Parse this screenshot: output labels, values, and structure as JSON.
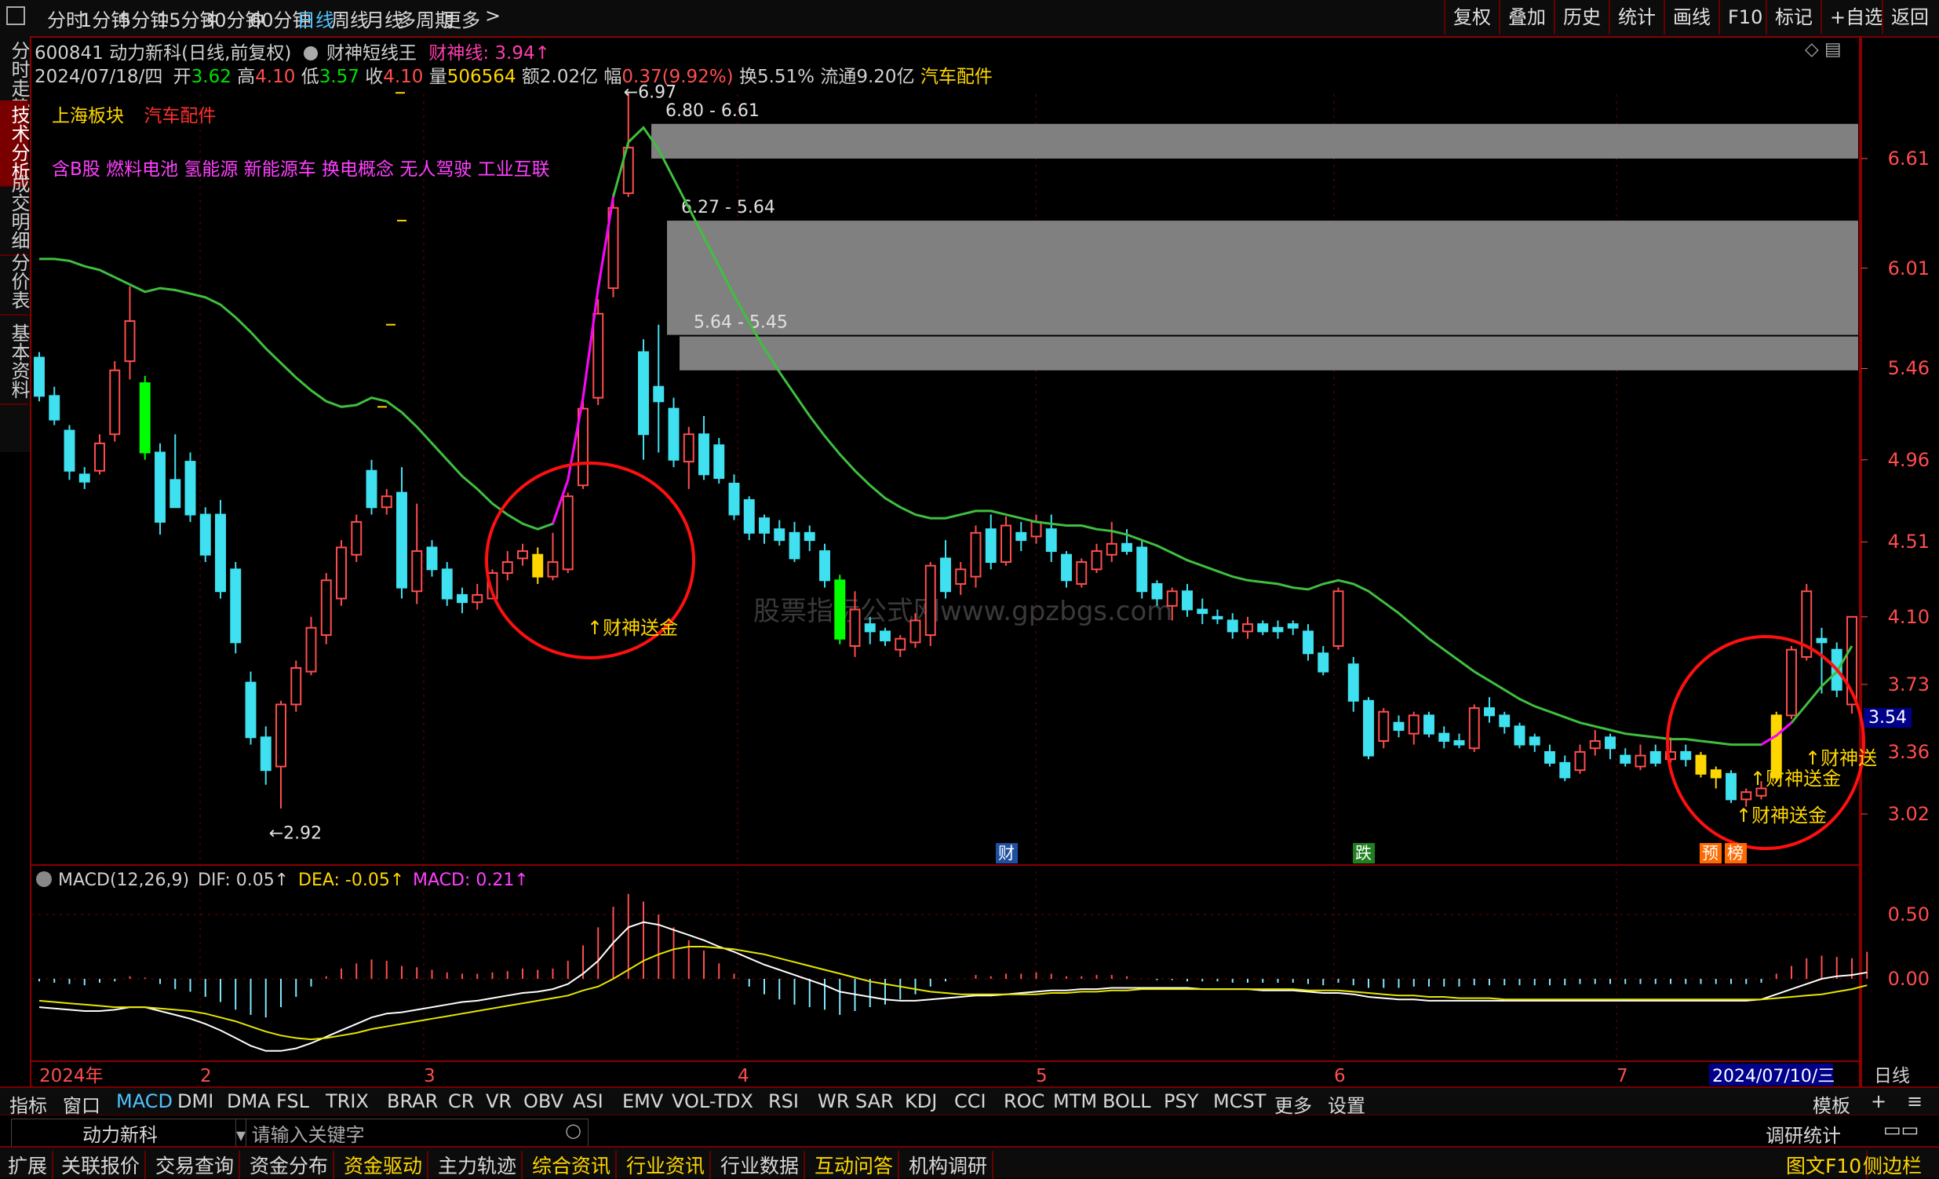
{
  "topbar": {
    "menu_icon": "window-menu-icon",
    "periods": [
      "分时",
      "1分钟",
      "5分钟",
      "15分钟",
      "30分钟",
      "60分钟",
      "日线",
      "周线",
      "月线",
      "多周期",
      "更多"
    ],
    "active_period": "日线",
    "right_buttons": [
      "复权",
      "叠加",
      "历史",
      "统计",
      "画线",
      "F10",
      "标记",
      "+自选",
      "返回"
    ]
  },
  "side_tabs": [
    "分时走势",
    "技术分析",
    "成交明细",
    "分价表",
    "基本资料"
  ],
  "active_side_tab": "技术分析",
  "header": {
    "stock": "600841 动力新科(日线,前复权)",
    "indicator_name": "财神短线王",
    "indicator_value": "财神线: 3.94↑",
    "date": "2024/07/18/四",
    "open_label": "开",
    "open": "3.62",
    "high_label": "高",
    "high": "4.10",
    "low_label": "低",
    "low": "3.57",
    "close_label": "收",
    "close": "4.10",
    "vol_label": "量",
    "vol": "506564",
    "amt": "额2.02亿",
    "chg_label": "幅",
    "chg": "0.37(9.92%)",
    "turnover": "换5.51%",
    "float": "流通9.20亿",
    "sector": "汽车配件"
  },
  "board": {
    "label": "上海板块",
    "value": "汽车配件"
  },
  "concepts": "含B股 燃料电池 氢能源 新能源车 换电概念 无人驾驶 工业互联",
  "watermark": "股票指标公式网www.gpzbgs.com",
  "annotations": {
    "high_mark": "6.97",
    "low_mark": "2.92",
    "zones": [
      "6.80 - 6.61",
      "6.27 - 5.64",
      "5.64 - 5.45"
    ],
    "signal_text": "↑财神送金",
    "signal_text_cut": "↑财神送",
    "markers": [
      "财",
      "跌",
      "预",
      "榜"
    ],
    "current_price_tag": "3.54"
  },
  "y_axis": {
    "ticks": [
      "6.61",
      "6.01",
      "5.46",
      "4.96",
      "4.51",
      "4.10",
      "3.73",
      "3.36",
      "3.02"
    ]
  },
  "macd": {
    "label": "MACD(12,26,9)",
    "dif": "DIF: 0.05↑",
    "dea": "DEA: -0.05↑",
    "macd": "MACD: 0.21↑",
    "ticks": [
      "0.50",
      "0.00"
    ]
  },
  "x_axis": {
    "labels": [
      "2024年",
      "2",
      "3",
      "4",
      "5",
      "6",
      "7"
    ],
    "cursor_date": "2024/07/10/三",
    "period": "日线"
  },
  "indicators": [
    "指标",
    "窗口",
    "MACD",
    "DMI",
    "DMA",
    "FSL",
    "TRIX",
    "BRAR",
    "CR",
    "VR",
    "OBV",
    "ASI",
    "EMV",
    "VOL-TDX",
    "RSI",
    "WR",
    "SAR",
    "KDJ",
    "CCI",
    "ROC",
    "MTM",
    "BOLL",
    "PSY",
    "MCST",
    "更多",
    "设置"
  ],
  "active_indicator": "MACD",
  "template_button": "模板",
  "search": {
    "stock": "动力新科",
    "placeholder": "请输入关键字",
    "right": "调研统计"
  },
  "bottom_tabs": [
    "扩展",
    "关联报价",
    "交易查询",
    "资金分布",
    "资金驱动",
    "主力轨迹",
    "综合资讯",
    "行业资讯",
    "行业数据",
    "互动问答",
    "机构调研"
  ],
  "bottom_right": [
    "图文F10",
    "侧边栏"
  ],
  "colors": {
    "up": "#ff4d4d",
    "down": "#3fe0f0",
    "bull_green": "#00ff00",
    "ma": "#3fbf3f",
    "signal": "#ffd700",
    "magenta": "#ff00ff",
    "zone": "#808080"
  },
  "chart_data": {
    "type": "candlestick",
    "candles": [
      [
        5.52,
        5.31,
        5.55,
        5.28
      ],
      [
        5.31,
        5.18,
        5.36,
        5.15
      ],
      [
        5.12,
        4.9,
        5.15,
        4.85
      ],
      [
        4.88,
        4.84,
        4.92,
        4.8
      ],
      [
        4.9,
        5.05,
        5.1,
        4.88
      ],
      [
        5.1,
        5.45,
        5.5,
        5.06
      ],
      [
        5.5,
        5.72,
        5.91,
        5.4
      ],
      [
        5.38,
        5.0,
        5.42,
        4.96
      ],
      [
        5.0,
        4.62,
        5.05,
        4.55
      ],
      [
        4.85,
        4.7,
        5.1,
        4.7
      ],
      [
        4.95,
        4.66,
        5.0,
        4.62
      ],
      [
        4.66,
        4.44,
        4.7,
        4.4
      ],
      [
        4.66,
        4.24,
        4.74,
        4.2
      ],
      [
        4.36,
        3.96,
        4.4,
        3.9
      ],
      [
        3.74,
        3.44,
        3.8,
        3.4
      ],
      [
        3.44,
        3.26,
        3.5,
        3.18
      ],
      [
        3.28,
        3.62,
        3.64,
        3.05
      ],
      [
        3.62,
        3.82,
        3.86,
        3.58
      ],
      [
        3.8,
        4.04,
        4.1,
        3.78
      ],
      [
        4.0,
        4.3,
        4.34,
        3.95
      ],
      [
        4.2,
        4.48,
        4.52,
        4.16
      ],
      [
        4.44,
        4.62,
        4.66,
        4.4
      ],
      [
        4.9,
        4.7,
        4.96,
        4.66
      ],
      [
        4.7,
        4.76,
        4.8,
        4.66
      ],
      [
        4.78,
        4.26,
        4.92,
        4.2
      ],
      [
        4.24,
        4.46,
        4.72,
        4.17
      ],
      [
        4.48,
        4.36,
        4.52,
        4.32
      ],
      [
        4.36,
        4.2,
        4.4,
        4.16
      ],
      [
        4.22,
        4.18,
        4.26,
        4.12
      ],
      [
        4.18,
        4.22,
        4.28,
        4.14
      ],
      [
        4.2,
        4.34,
        4.36,
        4.2
      ],
      [
        4.34,
        4.4,
        4.46,
        4.3
      ],
      [
        4.42,
        4.46,
        4.5,
        4.38
      ],
      [
        4.44,
        4.32,
        4.48,
        4.28
      ],
      [
        4.32,
        4.4,
        4.56,
        4.3
      ],
      [
        4.36,
        4.76,
        4.78,
        4.34
      ],
      [
        4.82,
        5.24,
        5.3,
        4.8
      ],
      [
        5.3,
        5.76,
        5.84,
        5.26
      ],
      [
        5.9,
        6.34,
        6.42,
        5.85
      ],
      [
        6.42,
        6.67,
        6.97,
        6.4
      ],
      [
        5.55,
        5.1,
        5.62,
        4.96
      ],
      [
        5.36,
        5.28,
        5.7,
        5.0
      ],
      [
        5.24,
        4.96,
        5.3,
        4.92
      ],
      [
        4.95,
        5.1,
        5.14,
        4.8
      ],
      [
        5.1,
        4.88,
        5.2,
        4.85
      ],
      [
        5.04,
        4.86,
        5.08,
        4.83
      ],
      [
        4.83,
        4.66,
        4.88,
        4.63
      ],
      [
        4.74,
        4.56,
        4.76,
        4.52
      ],
      [
        4.64,
        4.56,
        4.66,
        4.5
      ],
      [
        4.58,
        4.52,
        4.63,
        4.49
      ],
      [
        4.56,
        4.42,
        4.62,
        4.4
      ],
      [
        4.56,
        4.52,
        4.6,
        4.46
      ],
      [
        4.46,
        4.3,
        4.5,
        4.26
      ],
      [
        4.3,
        3.98,
        4.33,
        3.95
      ],
      [
        3.94,
        4.14,
        4.24,
        3.88
      ],
      [
        4.06,
        4.02,
        4.1,
        3.95
      ],
      [
        4.02,
        3.97,
        4.04,
        3.94
      ],
      [
        3.92,
        3.98,
        4.0,
        3.88
      ],
      [
        3.96,
        4.08,
        4.12,
        3.93
      ],
      [
        4.0,
        4.38,
        4.4,
        3.94
      ],
      [
        4.42,
        4.24,
        4.52,
        4.2
      ],
      [
        4.28,
        4.36,
        4.4,
        4.22
      ],
      [
        4.32,
        4.56,
        4.6,
        4.26
      ],
      [
        4.58,
        4.4,
        4.66,
        4.36
      ],
      [
        4.4,
        4.6,
        4.65,
        4.38
      ],
      [
        4.56,
        4.52,
        4.62,
        4.46
      ],
      [
        4.54,
        4.62,
        4.66,
        4.5
      ],
      [
        4.58,
        4.46,
        4.66,
        4.4
      ],
      [
        4.44,
        4.3,
        4.46,
        4.26
      ],
      [
        4.28,
        4.4,
        4.42,
        4.26
      ],
      [
        4.36,
        4.46,
        4.5,
        4.34
      ],
      [
        4.44,
        4.5,
        4.62,
        4.4
      ],
      [
        4.5,
        4.46,
        4.58,
        4.44
      ],
      [
        4.48,
        4.24,
        4.52,
        4.2
      ],
      [
        4.28,
        4.2,
        4.3,
        4.16
      ],
      [
        4.16,
        4.24,
        4.26,
        4.08
      ],
      [
        4.24,
        4.14,
        4.28,
        4.1
      ],
      [
        4.14,
        4.12,
        4.2,
        4.06
      ],
      [
        4.1,
        4.09,
        4.14,
        4.06
      ],
      [
        4.08,
        4.02,
        4.12,
        3.98
      ],
      [
        4.02,
        4.06,
        4.1,
        3.98
      ],
      [
        4.06,
        4.02,
        4.08,
        4.0
      ],
      [
        4.04,
        4.02,
        4.08,
        3.98
      ],
      [
        4.06,
        4.04,
        4.08,
        4.0
      ],
      [
        4.02,
        3.9,
        4.06,
        3.86
      ],
      [
        3.9,
        3.8,
        3.94,
        3.78
      ],
      [
        3.94,
        4.24,
        4.26,
        3.92
      ],
      [
        3.84,
        3.64,
        3.88,
        3.58
      ],
      [
        3.64,
        3.34,
        3.66,
        3.32
      ],
      [
        3.42,
        3.58,
        3.6,
        3.38
      ],
      [
        3.52,
        3.48,
        3.56,
        3.44
      ],
      [
        3.46,
        3.56,
        3.58,
        3.4
      ],
      [
        3.56,
        3.46,
        3.58,
        3.44
      ],
      [
        3.46,
        3.42,
        3.5,
        3.38
      ],
      [
        3.42,
        3.4,
        3.46,
        3.38
      ],
      [
        3.38,
        3.6,
        3.62,
        3.36
      ],
      [
        3.6,
        3.56,
        3.66,
        3.52
      ],
      [
        3.56,
        3.5,
        3.58,
        3.46
      ],
      [
        3.5,
        3.4,
        3.52,
        3.38
      ],
      [
        3.44,
        3.4,
        3.46,
        3.36
      ],
      [
        3.36,
        3.3,
        3.4,
        3.28
      ],
      [
        3.3,
        3.22,
        3.34,
        3.2
      ],
      [
        3.26,
        3.36,
        3.4,
        3.24
      ],
      [
        3.38,
        3.42,
        3.48,
        3.34
      ],
      [
        3.44,
        3.38,
        3.46,
        3.32
      ],
      [
        3.34,
        3.3,
        3.38,
        3.28
      ],
      [
        3.28,
        3.34,
        3.4,
        3.26
      ],
      [
        3.36,
        3.3,
        3.4,
        3.28
      ],
      [
        3.32,
        3.36,
        3.44,
        3.3
      ],
      [
        3.36,
        3.32,
        3.4,
        3.28
      ],
      [
        3.34,
        3.24,
        3.36,
        3.22
      ],
      [
        3.22,
        3.26,
        3.28,
        3.16
      ],
      [
        3.24,
        3.1,
        3.26,
        3.08
      ],
      [
        3.1,
        3.14,
        3.16,
        3.06
      ],
      [
        3.12,
        3.16,
        3.2,
        3.1
      ],
      [
        3.22,
        3.56,
        3.58,
        3.2
      ],
      [
        3.56,
        3.92,
        3.94,
        3.54
      ],
      [
        3.88,
        4.24,
        4.28,
        3.86
      ],
      [
        3.98,
        3.96,
        4.04,
        3.68
      ],
      [
        3.92,
        3.7,
        3.96,
        3.66
      ],
      [
        3.62,
        4.1,
        4.1,
        3.57
      ]
    ],
    "signal_days": [
      33,
      110,
      111,
      115
    ],
    "green_days": [
      7,
      53
    ],
    "ma_line": [
      6.06,
      6.06,
      6.05,
      6.02,
      6.0,
      5.96,
      5.92,
      5.88,
      5.9,
      5.89,
      5.87,
      5.85,
      5.81,
      5.74,
      5.66,
      5.57,
      5.49,
      5.41,
      5.34,
      5.28,
      5.25,
      5.26,
      5.3,
      5.28,
      5.22,
      5.14,
      5.05,
      4.96,
      4.87,
      4.8,
      4.72,
      4.66,
      4.61,
      4.58,
      4.61,
      4.85,
      5.3,
      5.9,
      6.4,
      6.7,
      6.78,
      6.66,
      6.5,
      6.34,
      6.18,
      6.02,
      5.86,
      5.71,
      5.57,
      5.44,
      5.32,
      5.2,
      5.09,
      4.99,
      4.9,
      4.82,
      4.75,
      4.7,
      4.66,
      4.64,
      4.64,
      4.66,
      4.68,
      4.68,
      4.66,
      4.64,
      4.62,
      4.61,
      4.6,
      4.6,
      4.58,
      4.57,
      4.55,
      4.52,
      4.49,
      4.45,
      4.41,
      4.38,
      4.35,
      4.32,
      4.3,
      4.29,
      4.28,
      4.26,
      4.25,
      4.28,
      4.3,
      4.28,
      4.24,
      4.18,
      4.12,
      4.05,
      3.98,
      3.92,
      3.86,
      3.8,
      3.75,
      3.7,
      3.65,
      3.61,
      3.58,
      3.55,
      3.52,
      3.5,
      3.48,
      3.46,
      3.45,
      3.44,
      3.43,
      3.43,
      3.42,
      3.41,
      3.4,
      3.4,
      3.4,
      3.45,
      3.52,
      3.62,
      3.72,
      3.8,
      3.94
    ],
    "macd_hist": [
      -0.02,
      -0.03,
      -0.04,
      -0.05,
      -0.03,
      -0.02,
      0.02,
      0.01,
      -0.04,
      -0.08,
      -0.1,
      -0.14,
      -0.18,
      -0.24,
      -0.28,
      -0.3,
      -0.22,
      -0.14,
      -0.06,
      0.02,
      0.08,
      0.12,
      0.15,
      0.14,
      0.1,
      0.09,
      0.07,
      0.05,
      0.04,
      0.04,
      0.05,
      0.06,
      0.08,
      0.07,
      0.08,
      0.14,
      0.26,
      0.4,
      0.56,
      0.66,
      0.6,
      0.5,
      0.4,
      0.3,
      0.22,
      0.12,
      0.04,
      -0.06,
      -0.12,
      -0.16,
      -0.2,
      -0.22,
      -0.24,
      -0.28,
      -0.25,
      -0.22,
      -0.2,
      -0.16,
      -0.12,
      -0.06,
      -0.02,
      0.0,
      0.03,
      0.02,
      0.04,
      0.04,
      0.05,
      0.04,
      0.02,
      0.02,
      0.03,
      0.03,
      0.02,
      0.0,
      -0.01,
      -0.01,
      -0.02,
      -0.02,
      -0.02,
      -0.03,
      -0.03,
      -0.03,
      -0.03,
      -0.03,
      -0.04,
      -0.05,
      -0.03,
      -0.05,
      -0.07,
      -0.07,
      -0.07,
      -0.06,
      -0.06,
      -0.06,
      -0.06,
      -0.05,
      -0.05,
      -0.05,
      -0.05,
      -0.05,
      -0.05,
      -0.05,
      -0.04,
      -0.04,
      -0.04,
      -0.04,
      -0.04,
      -0.04,
      -0.04,
      -0.04,
      -0.04,
      -0.04,
      -0.04,
      -0.04,
      -0.03,
      0.04,
      0.1,
      0.16,
      0.18,
      0.17,
      0.16,
      0.21
    ],
    "dif": [
      -0.22,
      -0.23,
      -0.24,
      -0.25,
      -0.25,
      -0.24,
      -0.22,
      -0.22,
      -0.25,
      -0.28,
      -0.31,
      -0.35,
      -0.4,
      -0.46,
      -0.52,
      -0.56,
      -0.56,
      -0.54,
      -0.5,
      -0.45,
      -0.4,
      -0.35,
      -0.3,
      -0.27,
      -0.26,
      -0.24,
      -0.22,
      -0.2,
      -0.18,
      -0.17,
      -0.15,
      -0.13,
      -0.11,
      -0.1,
      -0.08,
      -0.04,
      0.04,
      0.14,
      0.28,
      0.4,
      0.44,
      0.42,
      0.38,
      0.34,
      0.3,
      0.25,
      0.21,
      0.16,
      0.11,
      0.07,
      0.03,
      -0.01,
      -0.05,
      -0.1,
      -0.12,
      -0.14,
      -0.16,
      -0.17,
      -0.17,
      -0.16,
      -0.15,
      -0.14,
      -0.13,
      -0.13,
      -0.12,
      -0.11,
      -0.1,
      -0.09,
      -0.09,
      -0.08,
      -0.08,
      -0.07,
      -0.07,
      -0.07,
      -0.07,
      -0.07,
      -0.07,
      -0.08,
      -0.08,
      -0.08,
      -0.08,
      -0.09,
      -0.09,
      -0.09,
      -0.1,
      -0.11,
      -0.11,
      -0.12,
      -0.14,
      -0.15,
      -0.16,
      -0.16,
      -0.17,
      -0.17,
      -0.17,
      -0.17,
      -0.17,
      -0.17,
      -0.17,
      -0.17,
      -0.17,
      -0.17,
      -0.17,
      -0.17,
      -0.17,
      -0.17,
      -0.17,
      -0.17,
      -0.17,
      -0.17,
      -0.17,
      -0.17,
      -0.17,
      -0.17,
      -0.16,
      -0.12,
      -0.08,
      -0.04,
      0.0,
      0.02,
      0.03,
      0.05
    ],
    "dea": [
      -0.17,
      -0.18,
      -0.19,
      -0.2,
      -0.21,
      -0.22,
      -0.22,
      -0.22,
      -0.23,
      -0.24,
      -0.25,
      -0.27,
      -0.3,
      -0.33,
      -0.37,
      -0.41,
      -0.44,
      -0.46,
      -0.47,
      -0.46,
      -0.44,
      -0.42,
      -0.39,
      -0.37,
      -0.35,
      -0.33,
      -0.31,
      -0.29,
      -0.27,
      -0.25,
      -0.23,
      -0.21,
      -0.19,
      -0.17,
      -0.15,
      -0.13,
      -0.09,
      -0.06,
      0.0,
      0.07,
      0.14,
      0.19,
      0.23,
      0.25,
      0.25,
      0.24,
      0.23,
      0.21,
      0.19,
      0.16,
      0.13,
      0.1,
      0.07,
      0.04,
      0.01,
      -0.02,
      -0.04,
      -0.06,
      -0.08,
      -0.1,
      -0.11,
      -0.12,
      -0.12,
      -0.12,
      -0.12,
      -0.12,
      -0.12,
      -0.11,
      -0.11,
      -0.1,
      -0.1,
      -0.09,
      -0.09,
      -0.08,
      -0.08,
      -0.08,
      -0.08,
      -0.08,
      -0.08,
      -0.08,
      -0.08,
      -0.08,
      -0.08,
      -0.08,
      -0.09,
      -0.09,
      -0.09,
      -0.1,
      -0.11,
      -0.12,
      -0.13,
      -0.13,
      -0.14,
      -0.14,
      -0.15,
      -0.15,
      -0.15,
      -0.16,
      -0.16,
      -0.16,
      -0.16,
      -0.16,
      -0.16,
      -0.16,
      -0.16,
      -0.16,
      -0.16,
      -0.16,
      -0.16,
      -0.16,
      -0.16,
      -0.16,
      -0.16,
      -0.16,
      -0.16,
      -0.15,
      -0.14,
      -0.13,
      -0.12,
      -0.1,
      -0.08,
      -0.05
    ]
  }
}
